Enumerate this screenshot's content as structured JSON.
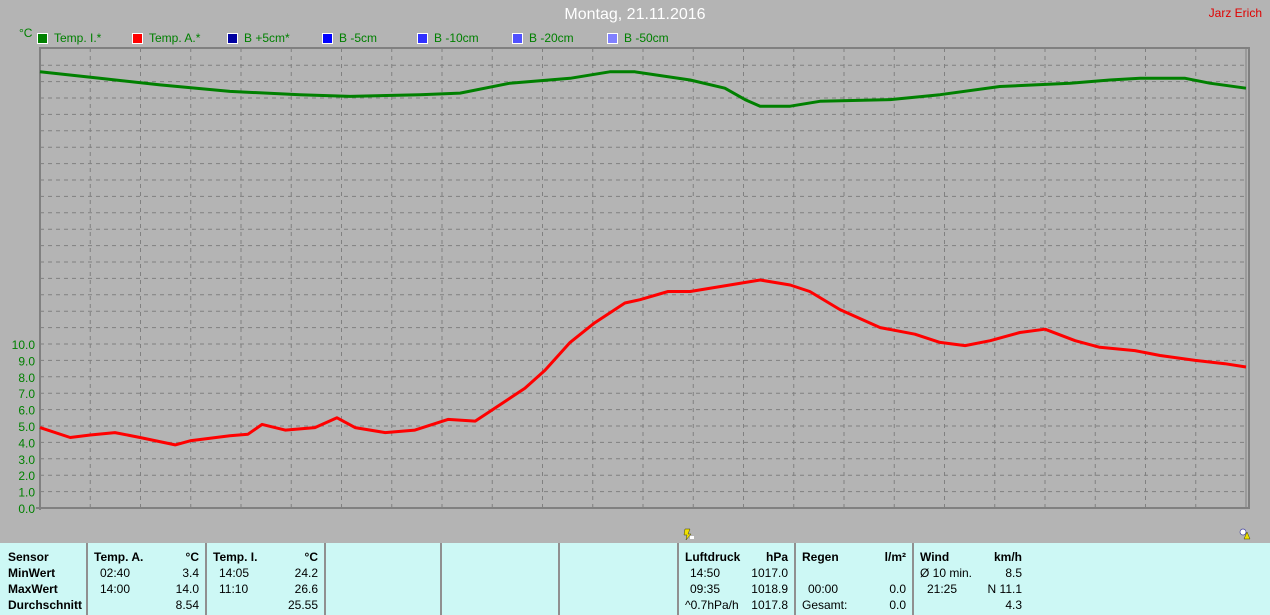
{
  "header": {
    "title": "Montag, 21.11.2016",
    "author": "Jarz Erich",
    "unit": "°C"
  },
  "legend": [
    {
      "label": "Temp. I.*",
      "color": "#008000"
    },
    {
      "label": "Temp. A.*",
      "color": "#ff0000"
    },
    {
      "label": "B +5cm*",
      "color": "#0000a0"
    },
    {
      "label": "B -5cm",
      "color": "#0000ff"
    },
    {
      "label": "B -10cm",
      "color": "#3030ff"
    },
    {
      "label": "B -20cm",
      "color": "#5050ff"
    },
    {
      "label": "B -50cm",
      "color": "#8080ff"
    }
  ],
  "icons": {
    "sunrise": "sunrise-icon",
    "sunset": "sunset-icon"
  },
  "chart_data": {
    "type": "line",
    "title": "Montag, 21.11.2016",
    "ylabel": "°C",
    "xlabel": "",
    "xlim": [
      0,
      24
    ],
    "ylim": [
      0,
      28
    ],
    "grid": true,
    "legend_position": "top",
    "yticks": [
      "0.0",
      "1.0",
      "2.0",
      "3.0",
      "4.0",
      "5.0",
      "6.0",
      "7.0",
      "8.0",
      "9.0",
      "10.0"
    ],
    "series": [
      {
        "name": "Temp. I.*",
        "color": "#008000",
        "x": [
          0,
          1.19,
          2.39,
          3.78,
          5.17,
          6.17,
          7.56,
          8.36,
          9.35,
          10.55,
          11.34,
          11.84,
          12.94,
          13.63,
          14.03,
          14.33,
          14.93,
          15.52,
          16.92,
          17.91,
          19.1,
          20.5,
          21.29,
          21.89,
          22.79,
          23.28,
          24
        ],
        "y": [
          26.6,
          26.2,
          25.8,
          25.4,
          25.2,
          25.1,
          25.2,
          25.3,
          25.9,
          26.2,
          26.6,
          26.6,
          26.1,
          25.6,
          24.9,
          24.5,
          24.5,
          24.8,
          24.9,
          25.2,
          25.7,
          25.9,
          26.1,
          26.2,
          26.2,
          25.9,
          25.6
        ]
      },
      {
        "name": "Temp. A.*",
        "color": "#ff0000",
        "x": [
          0,
          0.6,
          1.0,
          1.49,
          1.99,
          2.69,
          2.99,
          3.78,
          4.14,
          4.42,
          4.88,
          5.47,
          5.91,
          6.27,
          6.87,
          7.46,
          8.12,
          8.66,
          8.96,
          9.65,
          10.05,
          10.55,
          11.04,
          11.64,
          11.94,
          12.5,
          12.94,
          13.53,
          14.33,
          14.93,
          15.32,
          15.92,
          16.72,
          17.41,
          17.91,
          18.41,
          18.91,
          19.5,
          20.0,
          20.6,
          21.09,
          21.79,
          22.29,
          22.99,
          23.58,
          24
        ],
        "y": [
          4.9,
          4.3,
          4.45,
          4.6,
          4.3,
          3.85,
          4.1,
          4.4,
          4.5,
          5.1,
          4.75,
          4.9,
          5.5,
          4.9,
          4.6,
          4.75,
          5.4,
          5.3,
          5.9,
          7.3,
          8.4,
          10.1,
          11.3,
          12.5,
          12.7,
          13.2,
          13.2,
          13.5,
          13.9,
          13.6,
          13.2,
          12.1,
          11.0,
          10.6,
          10.1,
          9.9,
          10.2,
          10.7,
          10.9,
          10.2,
          9.8,
          9.6,
          9.3,
          9.0,
          8.8,
          8.6
        ]
      }
    ]
  },
  "panel": {
    "sensor": {
      "header": "Sensor",
      "rows": [
        "MinWert",
        "MaxWert",
        "Durchschnitt"
      ]
    },
    "temp_a": {
      "header": "Temp. A.",
      "unit": "°C",
      "min_time": "02:40",
      "min": "3.4",
      "max_time": "14:00",
      "max": "14.0",
      "avg": "8.54"
    },
    "temp_i": {
      "header": "Temp. I.",
      "unit": "°C",
      "min_time": "14:05",
      "min": "24.2",
      "max_time": "11:10",
      "max": "26.6",
      "avg": "25.55"
    },
    "pressure": {
      "header": "Luftdruck",
      "unit": "hPa",
      "min_time": "14:50",
      "min": "1017.0",
      "max_time": "09:35",
      "max": "1018.9",
      "trend": "^0.7hPa/h",
      "current": "1017.8"
    },
    "rain": {
      "header": "Regen",
      "unit": "l/m²",
      "time": "00:00",
      "value": "0.0",
      "total_label": "Gesamt:",
      "total": "0.0"
    },
    "wind": {
      "header": "Wind",
      "unit": "km/h",
      "avg_label": "Ø 10 min.",
      "avg": "8.5",
      "gust_time": "21:25",
      "gust": "N 11.1",
      "mean": "4.3"
    }
  }
}
